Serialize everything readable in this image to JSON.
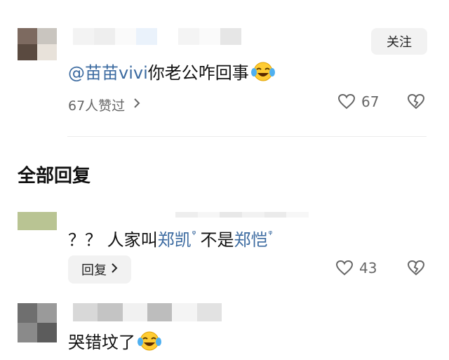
{
  "first_comment": {
    "follow_label": "关注",
    "mention": "@苗苗vivi",
    "text": " 你老公咋回事",
    "emoji": "laughing-crying-emoji",
    "likes_summary": "67人赞过",
    "like_count": "67"
  },
  "section": {
    "title": "全部回复"
  },
  "reply_1": {
    "prefix": "？？ 人家叫",
    "name_1": "郑凯",
    "middle": " 不是",
    "name_2": "郑恺",
    "search_mark": "ᵠ",
    "reply_label": "回复",
    "like_count": "43"
  },
  "reply_2": {
    "text": "哭错坟了",
    "emoji": "laughing-crying-emoji"
  },
  "colors": {
    "link": "#3b6aa0",
    "muted": "#666666",
    "button_bg": "#f2f2f2"
  }
}
